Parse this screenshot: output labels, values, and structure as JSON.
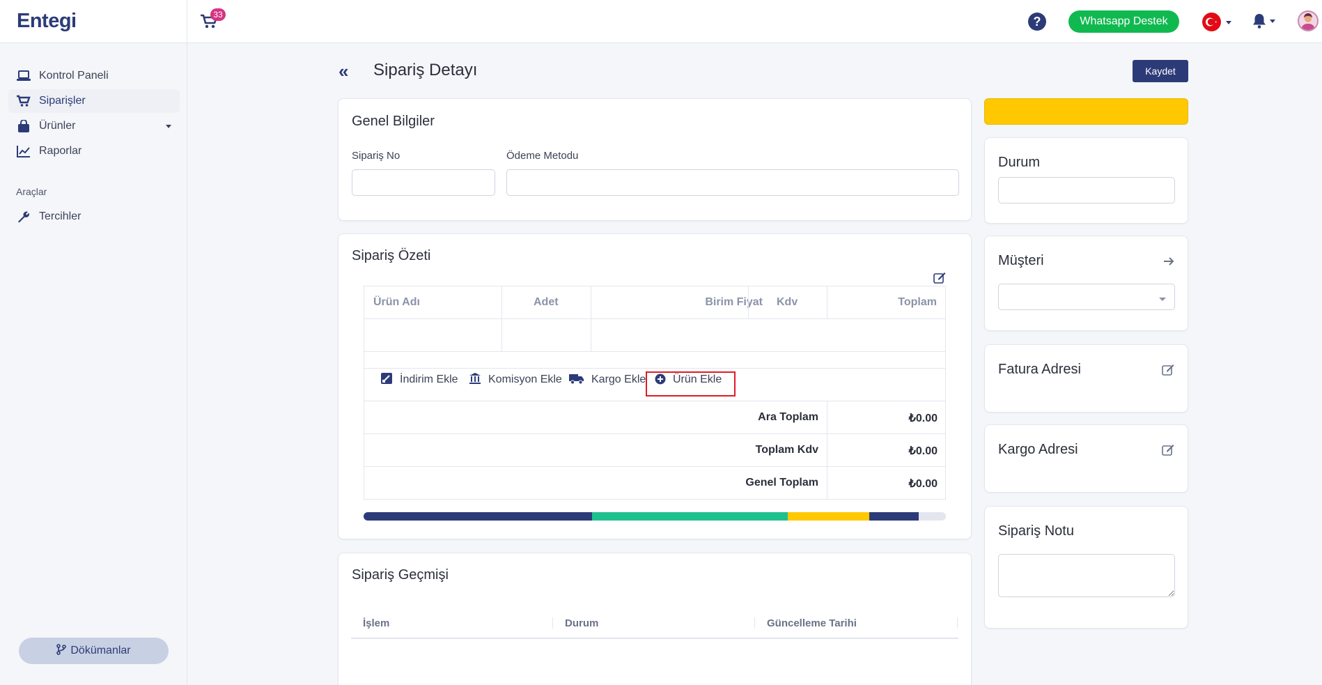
{
  "app": {
    "logo": "ntegi",
    "logo_mark": "E"
  },
  "topbar": {
    "cart_count": "33",
    "whatsapp_label": "Whatsapp Destek",
    "icons": [
      "cart-icon",
      "help-icon",
      "flag-tr-icon",
      "bell-icon",
      "avatar"
    ]
  },
  "sidebar": {
    "items": [
      {
        "label": "Kontrol Paneli",
        "icon": "laptop-icon"
      },
      {
        "label": "Siparişler",
        "icon": "cart-icon",
        "active": true
      },
      {
        "label": "Ürünler",
        "icon": "bag-icon",
        "expandable": true
      },
      {
        "label": "Raporlar",
        "icon": "chart-line-icon"
      }
    ],
    "section_label": "Araçlar",
    "tools": [
      {
        "label": "Tercihler",
        "icon": "wrench-icon"
      }
    ],
    "docs_label": "Dökümanlar"
  },
  "page": {
    "title": "Sipariş Detayı",
    "save_label": "Kaydet"
  },
  "general": {
    "title": "Genel Bilgiler",
    "order_no_label": "Sipariş No",
    "order_no_value": "",
    "payment_label": "Ödeme Metodu",
    "payment_value": ""
  },
  "summary": {
    "title": "Sipariş Özeti",
    "columns": [
      "Ürün Adı",
      "Adet",
      "Birim Fiyat",
      "Kdv",
      "Toplam"
    ],
    "actions": [
      "İndirim Ekle",
      "Komisyon Ekle",
      "Kargo Ekle",
      "Ürün Ekle"
    ],
    "totals": [
      {
        "label": "Ara Toplam",
        "value": "₺0.00"
      },
      {
        "label": "Toplam Kdv",
        "value": "₺0.00"
      },
      {
        "label": "Genel Toplam",
        "value": "₺0.00"
      }
    ],
    "progress_segments": [
      {
        "fraction": 0.392,
        "color": "#2c3b78"
      },
      {
        "fraction": 0.337,
        "color": "#20c08e"
      },
      {
        "fraction": 0.14,
        "color": "#ffc800"
      },
      {
        "fraction": 0.084,
        "color": "#2c3b78"
      }
    ]
  },
  "history": {
    "title": "Sipariş Geçmişi",
    "columns": [
      "İşlem",
      "Durum",
      "Güncelleme Tarihi"
    ]
  },
  "right": {
    "status_bar_color": "#ffc800",
    "status_title": "Durum",
    "status_value": "",
    "customer_title": "Müşteri",
    "customer_value": "",
    "invoice_title": "Fatura Adresi",
    "shipping_title": "Kargo Adresi",
    "note_title": "Sipariş Notu",
    "note_value": ""
  }
}
